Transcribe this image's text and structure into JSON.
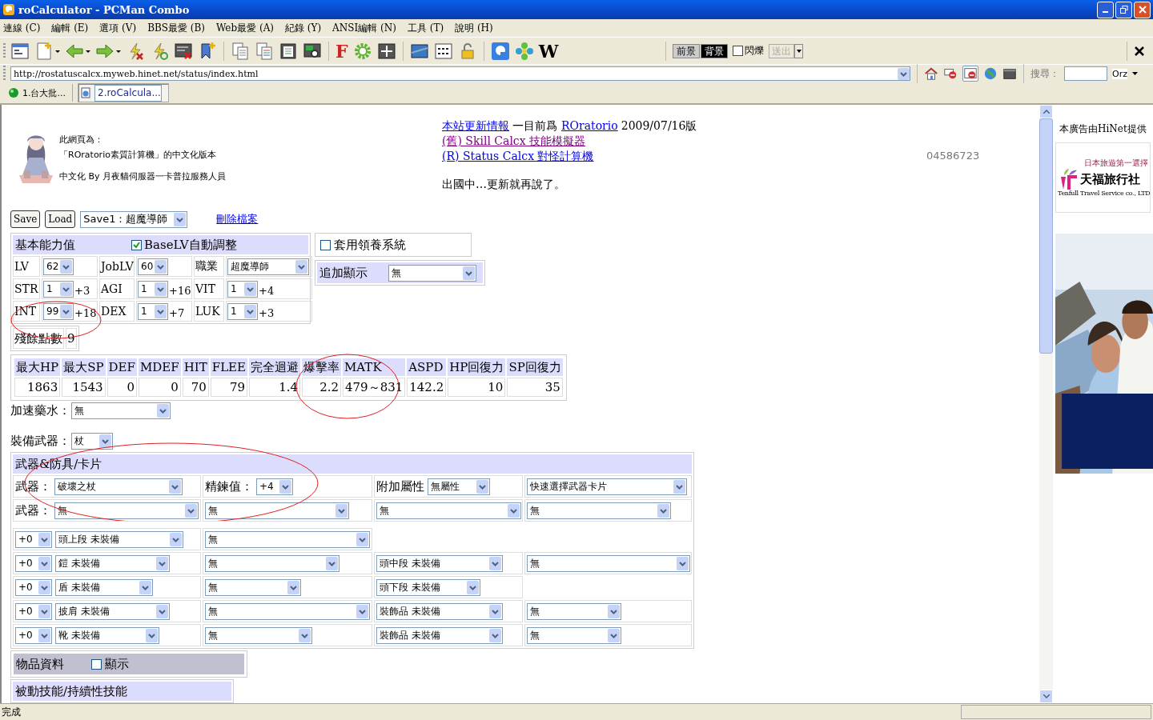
{
  "window": {
    "title": "roCalculator - PCMan Combo"
  },
  "menu": [
    "連線 (C)",
    "編輯 (E)",
    "選項 (V)",
    "BBS最愛 (B)",
    "Web最愛 (A)",
    "紀錄 (Y)",
    "ANSI編輯 (N)",
    "工具 (T)",
    "說明 (H)"
  ],
  "toolbar": {
    "font_button": "F",
    "wiki_button": "W",
    "foreground": "前景",
    "background": "背景",
    "blink": {
      "label": "閃爍",
      "checked": false
    },
    "send": {
      "label": "送出",
      "disabled": true
    }
  },
  "address_bar": {
    "url": "http://rostatuscalcx.myweb.hinet.net/status/index.html"
  },
  "search": {
    "label": "搜尋：",
    "engine": "Orz"
  },
  "tabs": [
    {
      "label": "1.台大批...",
      "selected": false,
      "kind": "bbs"
    },
    {
      "label": "2.roCalcula...",
      "selected": true,
      "kind": "web"
    }
  ],
  "header": {
    "intro": [
      "此網頁為：",
      "「ROratorio素質計算機」的中文化版本",
      "中文化 By 月夜貓伺服器一卡普拉服務人員"
    ],
    "news": [
      [
        {
          "text": "本站更新情報",
          "kind": "link"
        },
        {
          "text": "一目前爲",
          "kind": "plain"
        },
        {
          "text": "ROratorio",
          "kind": "link"
        },
        {
          "text": "2009/07/16版",
          "kind": "plain"
        }
      ],
      [
        {
          "text": "(舊) Skill Calcx 技能模擬器",
          "kind": "visited"
        }
      ],
      [
        {
          "text": "(R) Status Calcx 對怪計算機",
          "kind": "link"
        }
      ]
    ],
    "notice": "出國中…更新就再說了。",
    "counter": "04586723"
  },
  "save_bar": {
    "save": "Save",
    "load": "Load",
    "slot": "Save1：超魔導師",
    "delete": "刪除檔案"
  },
  "base_stats": {
    "title": "基本能力值",
    "auto_adjust": {
      "label": "BaseLV自動調整",
      "checked": true
    },
    "rows": [
      [
        {
          "label": "LV",
          "value": "62"
        },
        {
          "label": "JobLV",
          "value": "60"
        },
        {
          "label": "職業",
          "value": "超魔導師"
        }
      ],
      [
        {
          "label": "STR",
          "value": "1",
          "bonus": "+3"
        },
        {
          "label": "AGI",
          "value": "1",
          "bonus": "+16"
        },
        {
          "label": "VIT",
          "value": "1",
          "bonus": "+4"
        }
      ],
      [
        {
          "label": "INT",
          "value": "99",
          "bonus": "+18"
        },
        {
          "label": "DEX",
          "value": "1",
          "bonus": "+7"
        },
        {
          "label": "LUK",
          "value": "1",
          "bonus": "+3"
        }
      ]
    ],
    "remaining": {
      "label": "殘餘點數",
      "value": "9"
    }
  },
  "adoption": {
    "label": "套用領養系統",
    "checked": false
  },
  "extra_display": {
    "label": "追加顯示",
    "value": "無"
  },
  "derived": {
    "columns": [
      "最大HP",
      "最大SP",
      "DEF",
      "MDEF",
      "HIT",
      "FLEE",
      "完全迴避",
      "爆擊率",
      "MATK",
      "ASPD",
      "HP回復力",
      "SP回復力"
    ],
    "values": [
      "1863",
      "1543",
      "0",
      "0",
      "70",
      "79",
      "1.4",
      "2.2",
      "479～831",
      "142.2",
      "10",
      "35"
    ]
  },
  "speed_potion": {
    "label": "加速藥水：",
    "value": "無"
  },
  "weapon_type": {
    "label": "裝備武器：",
    "value": "杖"
  },
  "equipment": {
    "title": "武器&防具/卡片",
    "weapon_rows": [
      [
        {
          "label": "武器：",
          "value": "破壞之杖"
        },
        {
          "label": "精鍊值：",
          "value": "+4"
        },
        {
          "label": "附加屬性",
          "value": "無屬性"
        },
        {
          "value": "快速選擇武器卡片"
        }
      ],
      [
        {
          "label": "武器：",
          "value": "無"
        },
        {
          "value": "無"
        },
        {
          "value": "無"
        },
        {
          "value": "無"
        }
      ]
    ],
    "armor_rows": [
      {
        "refine": "+0",
        "item": "頭上段 未裝備",
        "card": "無"
      },
      {
        "refine": "+0",
        "item": "鎧 未裝備",
        "card": "無",
        "extra": "頭中段 未裝備",
        "extra_card": "無"
      },
      {
        "refine": "+0",
        "item": "盾 未裝備",
        "card": "無",
        "extra": "頭下段 未裝備"
      },
      {
        "refine": "+0",
        "item": "披肩 未裝備",
        "card": "無",
        "extra": "裝飾品 未裝備",
        "extra_card": "無"
      },
      {
        "refine": "+0",
        "item": "靴 未裝備",
        "card": "無",
        "extra": "裝飾品 未裝備",
        "extra_card": "無"
      }
    ]
  },
  "item_data": {
    "label": "物品資料",
    "show": {
      "label": "顯示",
      "checked": false
    }
  },
  "skills": {
    "title": "被動技能/持續性技能"
  },
  "ad": {
    "caption": "本廣告由HiNet提供",
    "banner": {
      "tagline": "日本旅遊第一選擇",
      "name": "天福旅行社",
      "english": "Tenfull Travel Service co., LTD"
    }
  },
  "status_bar": "完成"
}
